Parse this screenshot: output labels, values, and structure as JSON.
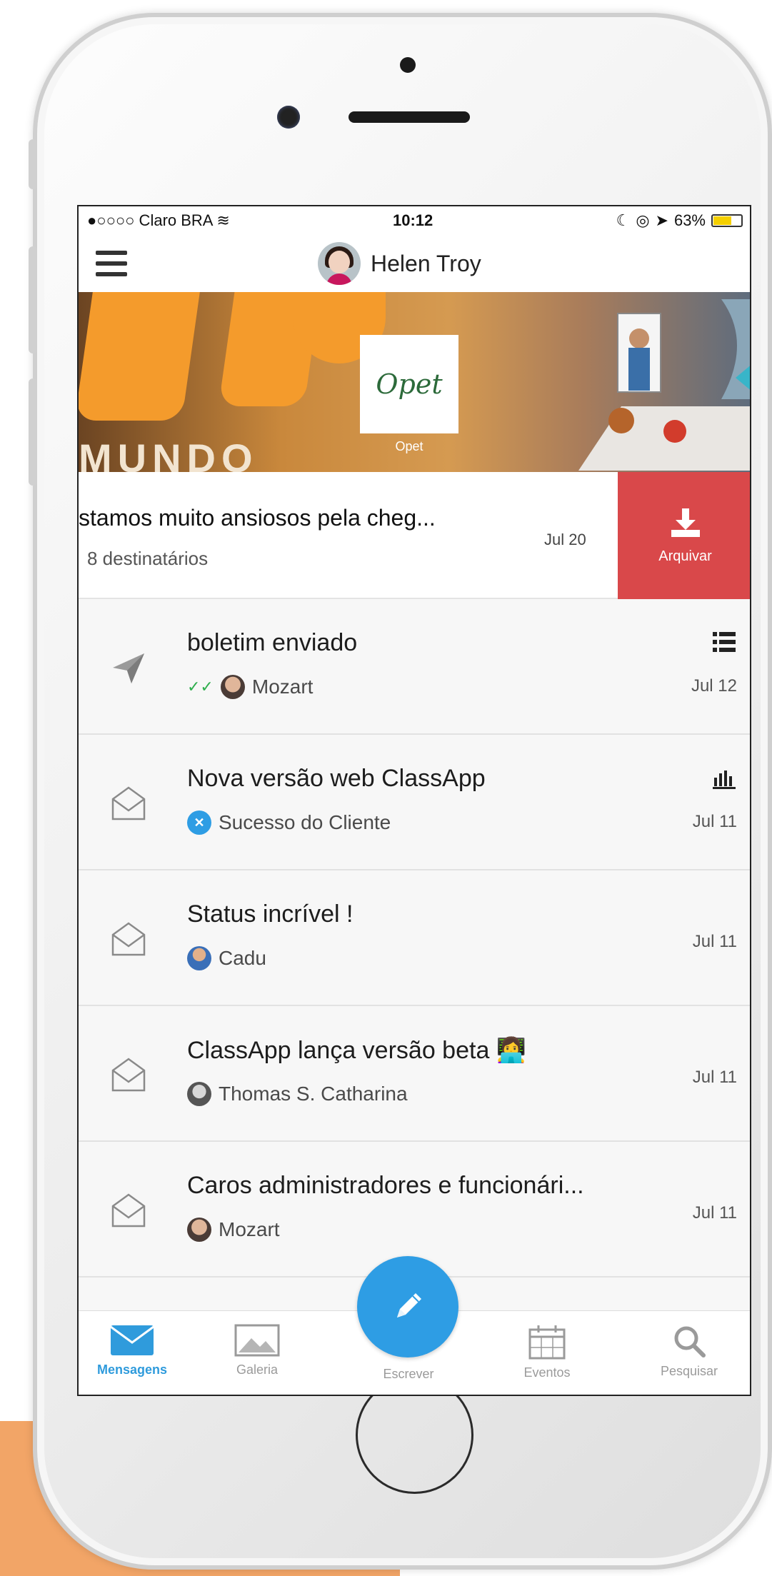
{
  "status_bar": {
    "carrier": "●○○○○ Claro BRA",
    "time": "10:12",
    "battery": "63%",
    "battery_level": 0.63
  },
  "nav": {
    "user_name": "Helen Troy"
  },
  "banner": {
    "logo_text": "Opet",
    "logo_caption": "Opet",
    "banner_word": "MUNDO"
  },
  "swiped_message": {
    "title": "stamos muito ansiosos pela cheg...",
    "subtitle": "8 destinatários",
    "date": "Jul 20",
    "action_label": "Arquivar"
  },
  "messages": [
    {
      "title": "boletim enviado",
      "sender": "Mozart",
      "date": "Jul 12",
      "icon": "paper-plane-icon",
      "flag": "list-icon"
    },
    {
      "title": "Nova versão web ClassApp",
      "sender": "Sucesso do Cliente",
      "date": "Jul 11",
      "icon": "envelope-open-icon",
      "flag": "bar-chart-icon"
    },
    {
      "title": "Status incrível !",
      "sender": "Cadu",
      "date": "Jul 11",
      "icon": "envelope-open-icon"
    },
    {
      "title": "ClassApp lança versão beta 👩‍💻",
      "sender": "Thomas S. Catharina",
      "date": "Jul 11",
      "icon": "envelope-open-icon"
    },
    {
      "title": "Caros administradores e funcionári...",
      "sender": "Mozart",
      "date": "Jul 11",
      "icon": "envelope-open-icon"
    }
  ],
  "tabs": [
    {
      "label": "Mensagens",
      "icon": "envelope-icon",
      "active": true
    },
    {
      "label": "Galeria",
      "icon": "image-icon"
    },
    {
      "label": "Escrever",
      "icon": "pencil-icon"
    },
    {
      "label": "Eventos",
      "icon": "calendar-icon"
    },
    {
      "label": "Pesquisar",
      "icon": "search-icon"
    }
  ],
  "colors": {
    "accent": "#2e9de4",
    "archive": "#d9484a",
    "background_blob": "#f2a567"
  }
}
